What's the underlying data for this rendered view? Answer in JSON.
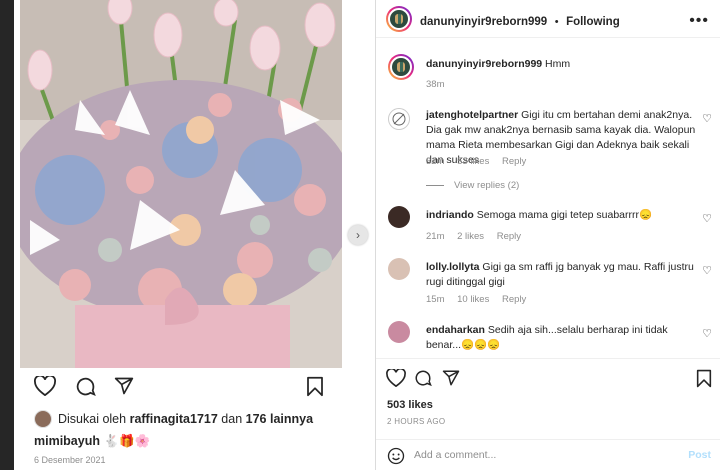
{
  "post": {
    "author": "danunyinyir9reborn999",
    "follow_status": "Following",
    "caption": "Hmm",
    "caption_time": "38m",
    "likes": "503 likes",
    "time_ago": "2 HOURS AGO",
    "add_comment_placeholder": "Add a comment...",
    "post_label": "Post"
  },
  "left_panel": {
    "liked_prefix": "Disukai oleh",
    "liked_user": "raffinagita1717",
    "liked_mid": "dan",
    "liked_others": "176 lainnya",
    "caption_user": "mimibayuh",
    "caption_emojis": "🐇🎁🌸",
    "date": "6 Desember 2021"
  },
  "comments": [
    {
      "user": "jatenghotelpartner",
      "text": "Gigi itu cm bertahan demi anak2nya. Dia gak mw anak2nya bernasib sama kayak dia. Walopun mama Rieta membesarkan Gigi dan Adeknya baik sekali dan sukses",
      "time": "32m",
      "likes": "53 likes",
      "reply": "Reply",
      "view_replies": "View replies (2)"
    },
    {
      "user": "indriando",
      "text": "Semoga mama gigi tetep suabarrrr😞",
      "time": "21m",
      "likes": "2 likes",
      "reply": "Reply"
    },
    {
      "user": "lolly.lollyta",
      "text": "Gigi ga sm raffi jg banyak yg mau. Raffi justru rugi ditinggal gigi",
      "time": "15m",
      "likes": "10 likes",
      "reply": "Reply"
    },
    {
      "user": "endaharkan",
      "text": "Sedih aja sih...selalu berharap ini tidak benar...😞😞😞",
      "time": "",
      "likes": "",
      "reply": ""
    }
  ],
  "icons": [
    "heart-icon",
    "comment-icon",
    "share-icon",
    "bookmark-icon",
    "more-icon",
    "emoji-icon",
    "chevron-right-icon"
  ]
}
